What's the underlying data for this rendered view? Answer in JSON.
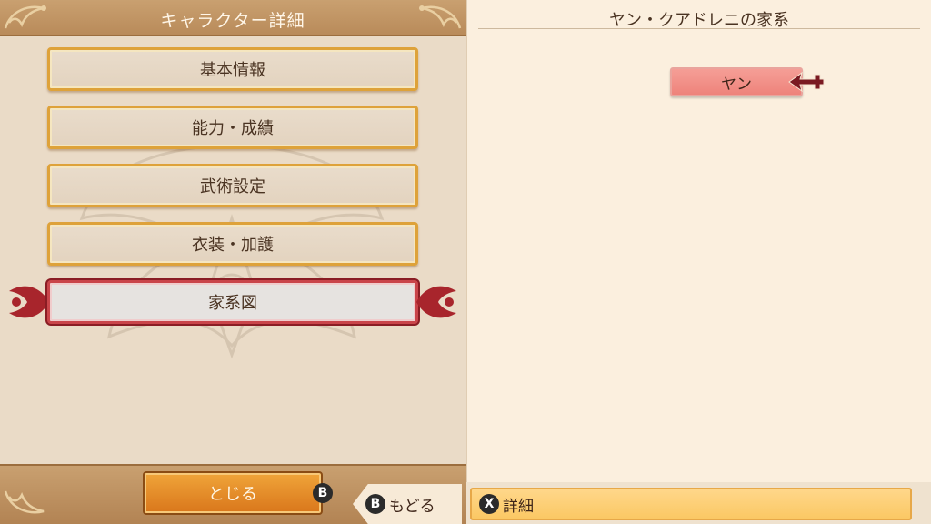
{
  "left": {
    "title": "キャラクター詳細",
    "menu": [
      {
        "label": "基本情報",
        "selected": false
      },
      {
        "label": "能力・成績",
        "selected": false
      },
      {
        "label": "武術設定",
        "selected": false
      },
      {
        "label": "衣装・加護",
        "selected": false
      },
      {
        "label": "家系図",
        "selected": true
      }
    ],
    "close_label": "とじる",
    "close_glyph": "B"
  },
  "right": {
    "title": "ヤン・クアドレニの家系",
    "tree_node": "ヤン"
  },
  "footer": {
    "back_glyph": "B",
    "back_label": "もどる",
    "detail_glyph": "X",
    "detail_label": "詳細"
  },
  "colors": {
    "header": "#b98b5a",
    "menu_border": "#dea23a",
    "selected_border": "#c9454a",
    "node_fill": "#ee837b",
    "accent_orange": "#e58a26"
  }
}
